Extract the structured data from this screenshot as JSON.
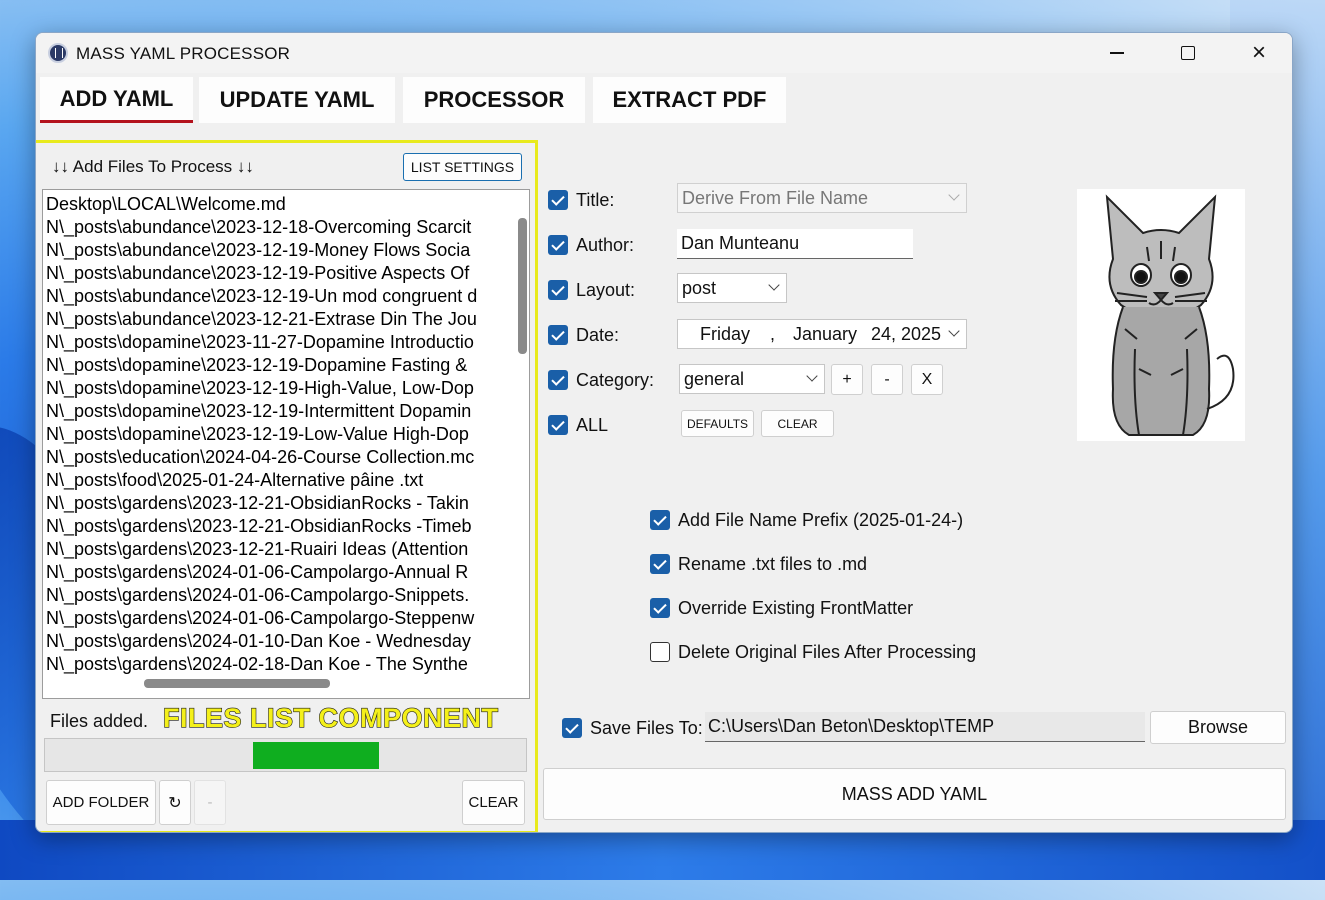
{
  "window": {
    "title": "MASS YAML PROCESSOR",
    "min": "minimize",
    "max": "maximize",
    "close": "×"
  },
  "tabs": [
    {
      "label": "ADD YAML",
      "active": true
    },
    {
      "label": "UPDATE YAML",
      "active": false
    },
    {
      "label": "PROCESSOR",
      "active": false
    },
    {
      "label": "EXTRACT PDF",
      "active": false
    }
  ],
  "files_panel": {
    "header": "↓↓ Add Files To Process ↓↓",
    "list_settings": "LIST SETTINGS",
    "files": [
      "Desktop\\LOCAL\\Welcome.md",
      "N\\_posts\\abundance\\2023-12-18-Overcoming Scarcit",
      "N\\_posts\\abundance\\2023-12-19-Money Flows Socia",
      "N\\_posts\\abundance\\2023-12-19-Positive Aspects Of",
      "N\\_posts\\abundance\\2023-12-19-Un mod congruent d",
      "N\\_posts\\abundance\\2023-12-21-Extrase Din The Jou",
      "N\\_posts\\dopamine\\2023-11-27-Dopamine Introductio",
      "N\\_posts\\dopamine\\2023-12-19-Dopamine Fasting &",
      "N\\_posts\\dopamine\\2023-12-19-High-Value, Low-Dop",
      "N\\_posts\\dopamine\\2023-12-19-Intermittent Dopamin",
      "N\\_posts\\dopamine\\2023-12-19-Low-Value High-Dop",
      "N\\_posts\\education\\2024-04-26-Course Collection.mc",
      "N\\_posts\\food\\2025-01-24-Alternative pâine .txt",
      "N\\_posts\\gardens\\2023-12-21-ObsidianRocks - Takin",
      "N\\_posts\\gardens\\2023-12-21-ObsidianRocks -Timeb",
      "N\\_posts\\gardens\\2023-12-21-Ruairi Ideas (Attention",
      "N\\_posts\\gardens\\2024-01-06-Campolargo-Annual R",
      "N\\_posts\\gardens\\2024-01-06-Campolargo-Snippets.",
      "N\\_posts\\gardens\\2024-01-06-Campolargo-Steppenw",
      "N\\_posts\\gardens\\2024-01-10-Dan Koe - Wednesday",
      "N\\_posts\\gardens\\2024-02-18-Dan Koe - The Synthe"
    ],
    "status": "Files added.",
    "overlay_label": "FILES LIST COMPONENT",
    "progress": 0.26,
    "buttons": {
      "add_folder": "ADD FOLDER",
      "refresh": "↻",
      "remove": "-",
      "clear": "CLEAR"
    }
  },
  "form": {
    "title": {
      "label": "Title:",
      "checked": true,
      "value": "Derive From File Name"
    },
    "author": {
      "label": "Author:",
      "checked": true,
      "value": "Dan Munteanu"
    },
    "layout": {
      "label": "Layout:",
      "checked": true,
      "value": "post"
    },
    "date": {
      "label": "Date:",
      "checked": true,
      "weekday": "Friday",
      "sep": ",",
      "month": "January",
      "day_year": "24, 2025"
    },
    "category": {
      "label": "Category:",
      "checked": true,
      "value": "general",
      "add": "+",
      "remove": "-",
      "delete": "X"
    },
    "all": {
      "label": "ALL",
      "checked": true,
      "defaults": "DEFAULTS",
      "clear": "CLEAR"
    }
  },
  "options": [
    {
      "label": "Add File Name Prefix (2025-01-24-)",
      "checked": true
    },
    {
      "label": "Rename .txt files to .md",
      "checked": true
    },
    {
      "label": "Override Existing FrontMatter",
      "checked": true
    },
    {
      "label": "Delete Original Files After Processing",
      "checked": false
    }
  ],
  "save": {
    "label": "Save Files To:",
    "checked": true,
    "path": "C:\\Users\\Dan Beton\\Desktop\\TEMP",
    "browse": "Browse"
  },
  "action": {
    "label": "MASS ADD YAML"
  },
  "icons": [
    "app-icon",
    "refresh-icon",
    "chevron-down-icon",
    "kitten-illustration"
  ],
  "colors": {
    "accent": "#1a5fa8",
    "tab_underline": "#b3121c",
    "progress": "#0fae1f",
    "highlight": "#e8ea1d"
  }
}
